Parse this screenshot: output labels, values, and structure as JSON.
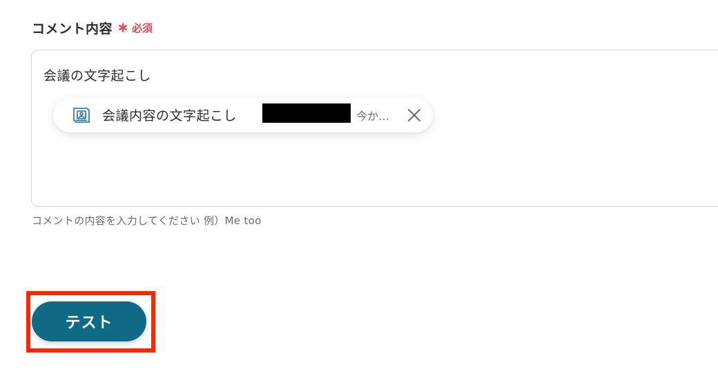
{
  "field": {
    "label": "コメント内容",
    "required_text": "必須",
    "required_icon": "asterisk-icon"
  },
  "comment": {
    "value": "会議の文字起こし",
    "variable_chip": {
      "icon": "document-image-icon",
      "label": "会議内容の文字起こし",
      "meta": "今か…",
      "close_icon": "close-icon"
    }
  },
  "hint": "コメントの内容を入力してください 例）Me too",
  "actions": {
    "test_label": "テスト"
  },
  "colors": {
    "accent": "#0e6a85",
    "required": "#e24a5a",
    "highlight": "#ff2600"
  }
}
